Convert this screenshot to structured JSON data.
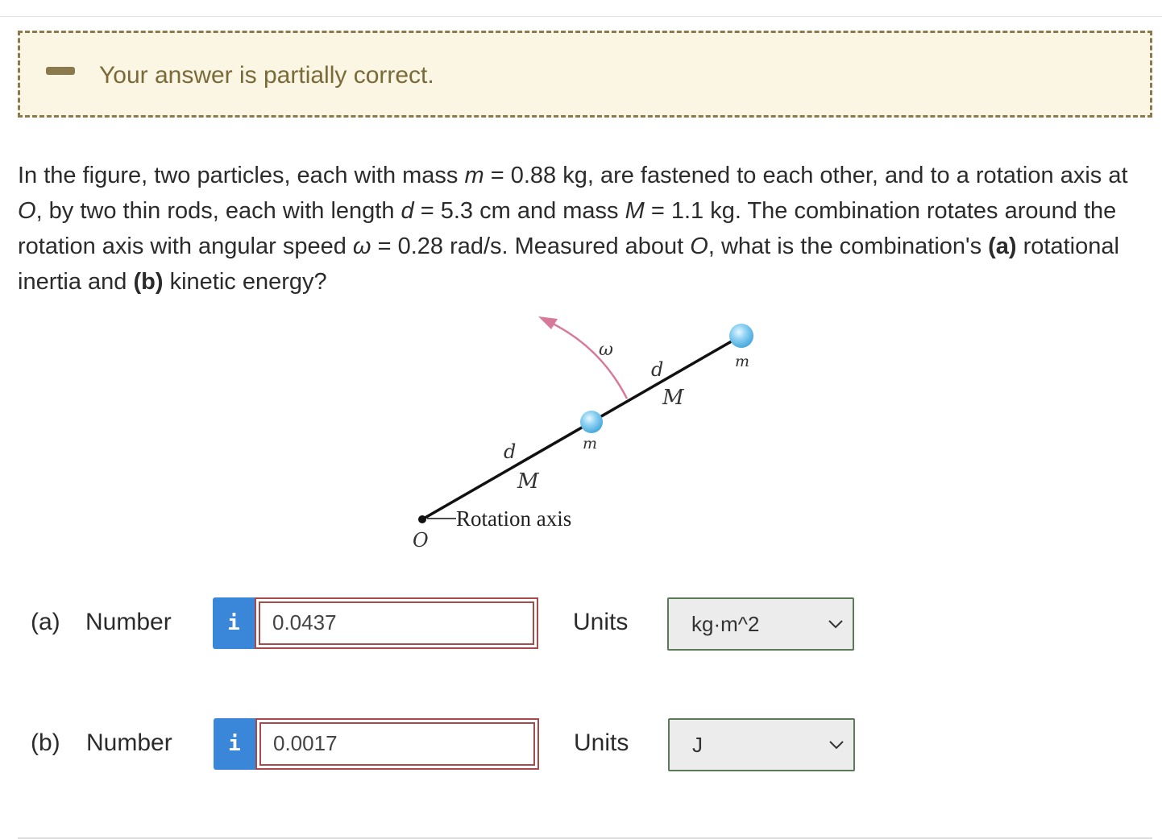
{
  "feedback": {
    "message": "Your answer is partially correct."
  },
  "question": {
    "p1": "In the figure, two particles, each with mass ",
    "m_sym": "m",
    "p2": " = 0.88 kg, are fastened to each other, and to a rotation axis at ",
    "O_sym": "O",
    "p3": ", by two thin rods, each with length ",
    "d_sym": "d",
    "p4": " = 5.3 cm and mass ",
    "M_sym": "M",
    "p5": " = 1.1 kg. The combination rotates around the rotation axis with angular speed ",
    "w_sym": "ω",
    "p6": " = 0.28 rad/s. Measured about ",
    "O_sym2": "O",
    "p7": ", what is the combination's ",
    "a_part": "(a)",
    "p8": " rotational inertia and ",
    "b_part": "(b)",
    "p9": " kinetic energy?"
  },
  "figure": {
    "omega": "ω",
    "d_outer": "d",
    "M_outer": "M",
    "m_outer": "m",
    "d_inner": "d",
    "M_inner": "M",
    "m_inner": "m",
    "axis_label": "Rotation axis",
    "origin": "O",
    "colors": {
      "particle": "#7cc8ef",
      "arrow": "#d77a9a",
      "rod": "#111111"
    }
  },
  "parts": [
    {
      "label": "(a)",
      "number_label": "Number",
      "info": "i",
      "value": "0.0437",
      "units_label": "Units",
      "unit": "kg·m^2"
    },
    {
      "label": "(b)",
      "number_label": "Number",
      "info": "i",
      "value": "0.0017",
      "units_label": "Units",
      "unit": "J"
    }
  ]
}
